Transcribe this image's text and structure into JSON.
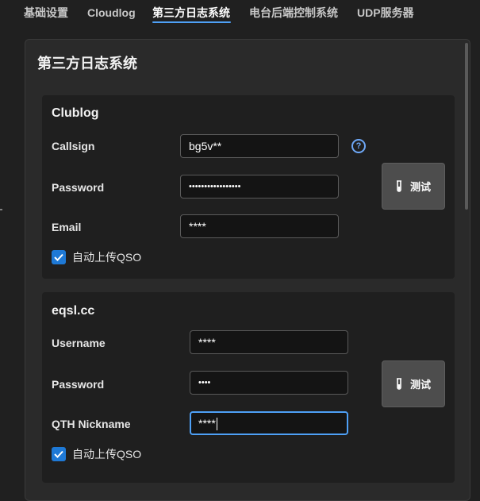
{
  "tabs": [
    {
      "label": "基础设置",
      "active": false
    },
    {
      "label": "Cloudlog",
      "active": false
    },
    {
      "label": "第三方日志系统",
      "active": true
    },
    {
      "label": "电台后端控制系统",
      "active": false
    },
    {
      "label": "UDP服务器",
      "active": false
    }
  ],
  "panel": {
    "title": "第三方日志系统"
  },
  "clublog": {
    "title": "Clublog",
    "callsign_label": "Callsign",
    "callsign_value": "bg5v**",
    "password_label": "Password",
    "password_value": "•••••••••••••••••",
    "email_label": "Email",
    "email_value": "****",
    "auto_upload_label": "自动上传QSO",
    "auto_upload_checked": true,
    "test_label": "测试",
    "help_icon": "question-circle-icon"
  },
  "eqsl": {
    "title": "eqsl.cc",
    "username_label": "Username",
    "username_value": "****",
    "password_label": "Password",
    "password_value": "••••",
    "qth_label": "QTH Nickname",
    "qth_value": "****",
    "auto_upload_label": "自动上传QSO",
    "auto_upload_checked": true,
    "test_label": "测试"
  },
  "colors": {
    "accent": "#4ea0f6",
    "checkbox": "#1e79d6",
    "background": "#202020"
  }
}
